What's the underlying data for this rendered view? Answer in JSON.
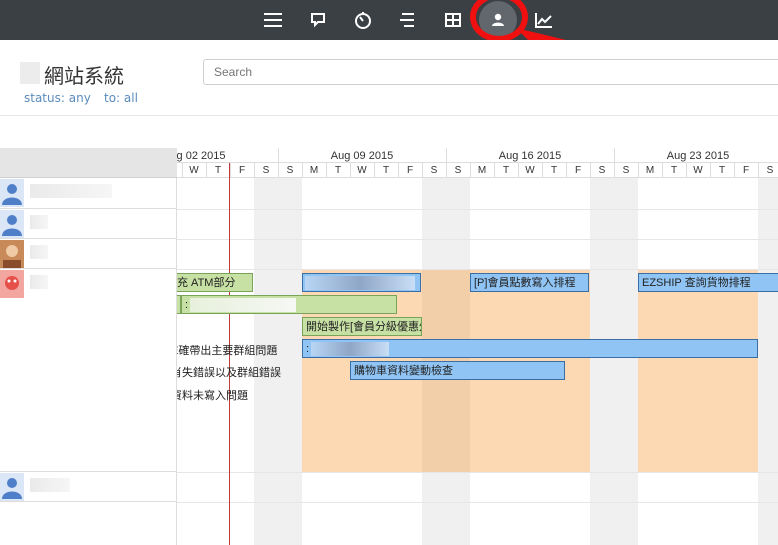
{
  "toolbar": {
    "icons": [
      "menu-icon",
      "comment-icon",
      "timer-icon",
      "align-icon",
      "grid-icon",
      "user-icon",
      "chart-icon"
    ],
    "active": "user-icon"
  },
  "header": {
    "title": "網站系統",
    "filter_status": "status: any",
    "filter_to": "to: all",
    "search_placeholder": "Search"
  },
  "calendar": {
    "weeks": [
      "g 02 2015",
      "Aug 09 2015",
      "Aug 16 2015",
      "Aug 23 2015"
    ],
    "days": [
      "W",
      "T",
      "F",
      "S",
      "S",
      "M",
      "T",
      "W",
      "T",
      "F",
      "S",
      "S",
      "M",
      "T",
      "W",
      "T",
      "F",
      "S",
      "S",
      "M",
      "T",
      "W",
      "T",
      "F",
      "S"
    ]
  },
  "tasks": {
    "atm": "充 ATM部分",
    "member_points": "[P]會員點數寫入排程",
    "ezship": "EZSHIP 查詢貨物排程",
    "member_discount": "開始製作[會員分級優惠外掛]",
    "group_issue": "E確帶出主要群組問題",
    "sync_error": "肖失錯誤以及群組錯誤",
    "cart_check": "購物車資料變動檢查",
    "data_missing": "資料未寫入問題",
    "blur_colon": ":"
  },
  "colors": {
    "topbar": "#3b4045",
    "bar_blue": "#90c4f4",
    "bar_green": "#c7e0a4",
    "highlight": "#fcd9b2",
    "today_line": "#c23b3b",
    "annotation": "#f01010"
  }
}
